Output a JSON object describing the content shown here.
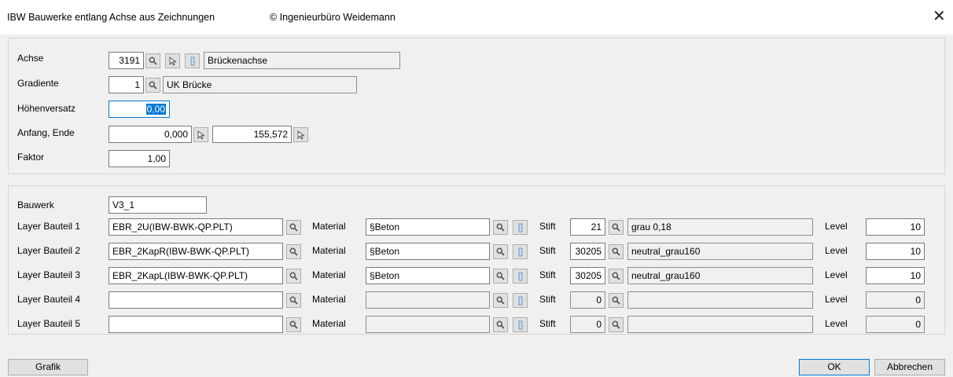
{
  "window": {
    "title": "IBW Bauwerke entlang Achse aus Zeichnungen",
    "copyright": "© Ingenieurbüro Weidemann",
    "close_glyph": "✕"
  },
  "axis": {
    "achse_label": "Achse",
    "achse_number": "3191",
    "achse_name": "Brückenachse",
    "gradiente_label": "Gradiente",
    "gradiente_number": "1",
    "gradiente_name": "UK Brücke",
    "hoehenversatz_label": "Höhenversatz",
    "hoehenversatz_value": "0,00",
    "anfang_ende_label": "Anfang, Ende",
    "anfang_value": "0,000",
    "ende_value": "155,572",
    "faktor_label": "Faktor",
    "faktor_value": "1,00"
  },
  "bauwerk": {
    "label": "Bauwerk",
    "value": "V3_1",
    "material_label": "Material",
    "stift_label": "Stift",
    "level_label": "Level",
    "rows": [
      {
        "label": "Layer Bauteil 1",
        "layer": "EBR_2U(IBW-BWK-QP.PLT)",
        "material": "§Beton",
        "stift": "21",
        "stift_name": "grau 0,18",
        "level": "10"
      },
      {
        "label": "Layer Bauteil 2",
        "layer": "EBR_2KapR(IBW-BWK-QP.PLT)",
        "material": "§Beton",
        "stift": "30205",
        "stift_name": "neutral_grau160",
        "level": "10"
      },
      {
        "label": "Layer Bauteil 3",
        "layer": "EBR_2KapL(IBW-BWK-QP.PLT)",
        "material": "§Beton",
        "stift": "30205",
        "stift_name": "neutral_grau160",
        "level": "10"
      },
      {
        "label": "Layer Bauteil 4",
        "layer": "",
        "material": "",
        "stift": "0",
        "stift_name": "",
        "level": "0"
      },
      {
        "label": "Layer Bauteil 5",
        "layer": "",
        "material": "",
        "stift": "0",
        "stift_name": "",
        "level": "0"
      }
    ]
  },
  "footer": {
    "grafik_label": "Grafik",
    "ok_label": "OK",
    "abbrechen_label": "Abbrechen"
  },
  "icons": {
    "search": "magnifier-icon",
    "pick": "cursor-arrow-icon",
    "info": "info-icon"
  },
  "colors": {
    "accent": "#0078d7",
    "dialog_bg": "#f0f0f0"
  }
}
